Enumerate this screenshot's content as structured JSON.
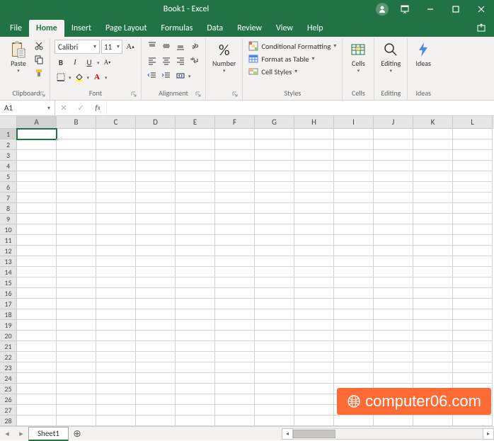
{
  "title": "Book1 - Excel",
  "tabs": [
    "File",
    "Home",
    "Insert",
    "Page Layout",
    "Formulas",
    "Data",
    "Review",
    "View",
    "Help"
  ],
  "active_tab": "Home",
  "clipboard": {
    "label": "Clipboard",
    "paste": "Paste"
  },
  "font": {
    "label": "Font",
    "name": "Calibri",
    "size": "11",
    "bold": "B",
    "italic": "I",
    "underline": "U"
  },
  "alignment": {
    "label": "Alignment"
  },
  "number": {
    "label": "Number",
    "percent": "%"
  },
  "styles": {
    "label": "Styles",
    "cond": "Conditional Formatting",
    "table": "Format as Table",
    "cell": "Cell Styles"
  },
  "cells_group": {
    "label": "Cells",
    "btn": "Cells"
  },
  "editing": {
    "label": "Editing",
    "btn": "Editing"
  },
  "ideas": {
    "label": "Ideas",
    "btn": "Ideas"
  },
  "namebox": "A1",
  "columns": [
    "A",
    "B",
    "C",
    "D",
    "E",
    "F",
    "G",
    "H",
    "I",
    "J",
    "K",
    "L"
  ],
  "active_cell": {
    "row": 0,
    "col": 0
  },
  "row_count": 28,
  "sheet": {
    "navprev": "◂",
    "navnext": "▸",
    "tab1": "Sheet1",
    "add": "⊕"
  },
  "watermark": "computer06.com"
}
